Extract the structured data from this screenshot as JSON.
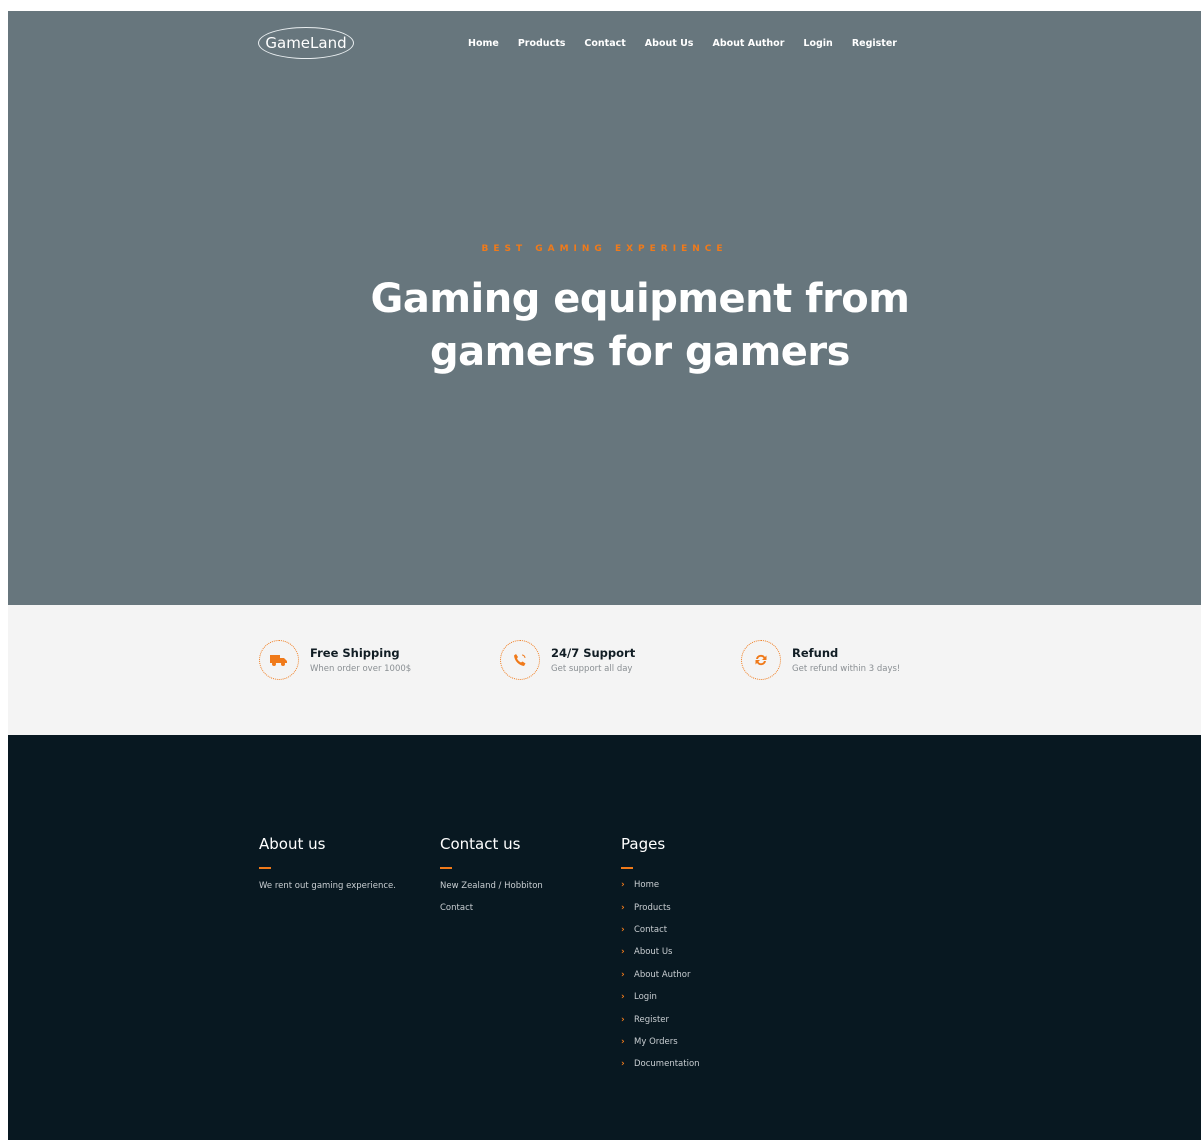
{
  "brand": {
    "logo_text": "GameLand"
  },
  "nav": {
    "items": [
      "Home",
      "Products",
      "Contact",
      "About Us",
      "About Author",
      "Login",
      "Register"
    ]
  },
  "hero": {
    "eyebrow": "BEST GAMING EXPERIENCE",
    "headline_line1": "Gaming equipment from",
    "headline_line2": "gamers for gamers",
    "background_color": "#67767d"
  },
  "features": [
    {
      "icon": "truck-icon",
      "title": "Free Shipping",
      "subtitle": "When order over 1000$"
    },
    {
      "icon": "phone-icon",
      "title": "24/7 Support",
      "subtitle": "Get support all day"
    },
    {
      "icon": "refresh-icon",
      "title": "Refund",
      "subtitle": "Get refund within 3 days!"
    }
  ],
  "footer": {
    "about": {
      "title": "About us",
      "text": "We rent out gaming experience."
    },
    "contact": {
      "title": "Contact us",
      "address": "New Zealand / Hobbiton",
      "contact_link": "Contact"
    },
    "pages": {
      "title": "Pages",
      "items": [
        "Home",
        "Products",
        "Contact",
        "About Us",
        "About Author",
        "Login",
        "Register",
        "My Orders",
        "Documentation"
      ]
    },
    "background_color": "#081821"
  },
  "colors": {
    "accent": "#f07a1a"
  }
}
